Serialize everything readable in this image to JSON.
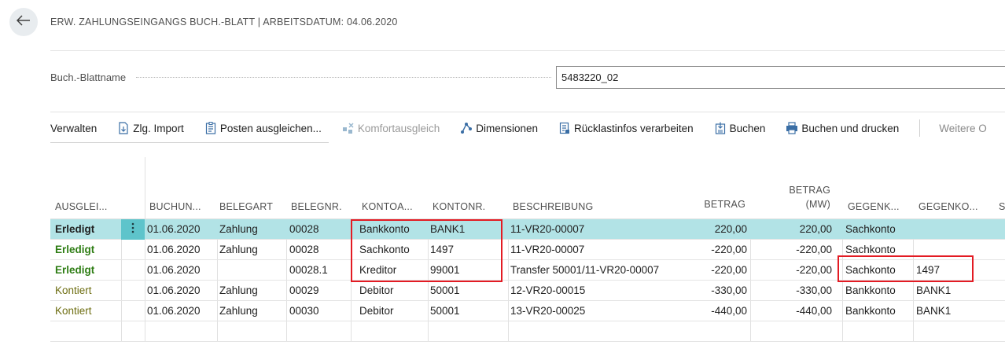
{
  "header": {
    "title": "ERW. ZAHLUNGSEINGANGS BUCH.-BLATT | ARBEITSDATUM: 04.06.2020"
  },
  "field": {
    "label": "Buch.-Blattname",
    "value": "5483220_02"
  },
  "actions": {
    "verwalten": "Verwalten",
    "zlg_import": "Zlg. Import",
    "posten": "Posten ausgleichen...",
    "komfort": "Komfortausgleich",
    "dimensionen": "Dimensionen",
    "ruecklast": "Rücklastinfos verarbeiten",
    "buchen": "Buchen",
    "buchen_drucken": "Buchen und drucken",
    "weitere": "Weitere O"
  },
  "columns": {
    "ausgleich": "AUSGLEI...",
    "buchung": "BUCHUN...",
    "belegart": "BELEGART",
    "belegnr": "BELEGNR.",
    "kontoart": "KONTOA...",
    "kontonr": "KONTONR.",
    "beschreibung": "BESCHREIBUNG",
    "betrag": "BETRAG",
    "betrag_mw_1": "BETRAG",
    "betrag_mw_2": "(MW)",
    "gegenart": "GEGENK...",
    "gegennr": "GEGENKO...",
    "extra": "S"
  },
  "rows": [
    {
      "status": "Erledigt",
      "datum": "01.06.2020",
      "belegart": "Zahlung",
      "belegnr": "00028",
      "kontoart": "Bankkonto",
      "kontonr": "BANK1",
      "beschreibung": "11-VR20-00007",
      "betrag": "220,00",
      "betrag_mw": "220,00",
      "gegenart": "Sachkonto",
      "gegennr": ""
    },
    {
      "status": "Erledigt",
      "datum": "01.06.2020",
      "belegart": "Zahlung",
      "belegnr": "00028",
      "kontoart": "Sachkonto",
      "kontonr": "1497",
      "beschreibung": "11-VR20-00007",
      "betrag": "-220,00",
      "betrag_mw": "-220,00",
      "gegenart": "Sachkonto",
      "gegennr": ""
    },
    {
      "status": "Erledigt",
      "datum": "01.06.2020",
      "belegart": "",
      "belegnr": "00028.1",
      "kontoart": "Kreditor",
      "kontonr": "99001",
      "beschreibung": "Transfer 50001/11-VR20-00007",
      "betrag": "-220,00",
      "betrag_mw": "-220,00",
      "gegenart": "Sachkonto",
      "gegennr": "1497"
    },
    {
      "status": "Kontiert",
      "datum": "01.06.2020",
      "belegart": "Zahlung",
      "belegnr": "00029",
      "kontoart": "Debitor",
      "kontonr": "50001",
      "beschreibung": "12-VR20-00015",
      "betrag": "-330,00",
      "betrag_mw": "-330,00",
      "gegenart": "Bankkonto",
      "gegennr": "BANK1"
    },
    {
      "status": "Kontiert",
      "datum": "01.06.2020",
      "belegart": "Zahlung",
      "belegnr": "00030",
      "kontoart": "Debitor",
      "kontonr": "50001",
      "beschreibung": "13-VR20-00025",
      "betrag": "-440,00",
      "betrag_mw": "-440,00",
      "gegenart": "Bankkonto",
      "gegennr": "BANK1"
    }
  ],
  "colors": {
    "selected_row": "#b2e3e6",
    "status_done": "#2e7d14",
    "status_posted": "#6e6e12",
    "highlight": "#e31b23"
  }
}
